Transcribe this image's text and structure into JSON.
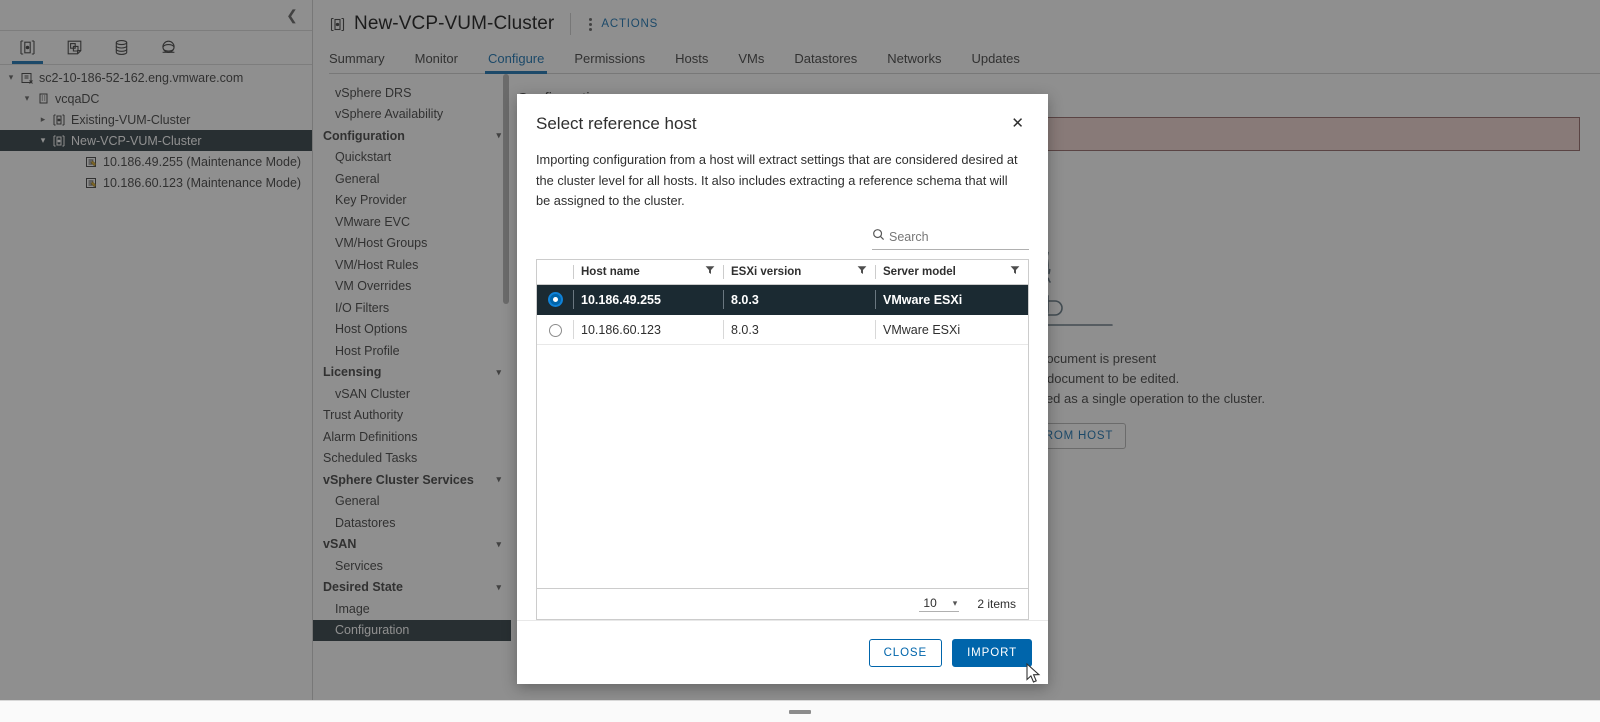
{
  "left_pane": {
    "collapse_icon": "chevron-left-icon",
    "icon_tabs": [
      {
        "name": "hosts-and-clusters-icon",
        "active": true
      },
      {
        "name": "vms-and-templates-icon",
        "active": false
      },
      {
        "name": "storage-icon",
        "active": false
      },
      {
        "name": "networking-icon",
        "active": false
      }
    ],
    "tree": [
      {
        "label": "sc2-10-186-52-162.eng.vmware.com",
        "depth": 0,
        "caret": "expanded",
        "icon": "vcenter-icon",
        "selected": false
      },
      {
        "label": "vcqaDC",
        "depth": 1,
        "caret": "expanded",
        "icon": "datacenter-icon",
        "selected": false
      },
      {
        "label": "Existing-VUM-Cluster",
        "depth": 2,
        "caret": "collapsed",
        "icon": "cluster-icon",
        "selected": false
      },
      {
        "label": "New-VCP-VUM-Cluster",
        "depth": 2,
        "caret": "expanded",
        "icon": "cluster-icon",
        "selected": true
      },
      {
        "label": "10.186.49.255 (Maintenance Mode)",
        "depth": 3,
        "caret": "none",
        "icon": "host-maintenance-icon",
        "selected": false
      },
      {
        "label": "10.186.60.123 (Maintenance Mode)",
        "depth": 3,
        "caret": "none",
        "icon": "host-maintenance-icon",
        "selected": false
      }
    ]
  },
  "header": {
    "object_icon": "cluster-icon",
    "title": "New-VCP-VUM-Cluster",
    "kebab_icon": "more-actions-icon",
    "actions_label": "ACTIONS",
    "tabs": [
      {
        "label": "Summary",
        "active": false
      },
      {
        "label": "Monitor",
        "active": false
      },
      {
        "label": "Configure",
        "active": true
      },
      {
        "label": "Permissions",
        "active": false
      },
      {
        "label": "Hosts",
        "active": false
      },
      {
        "label": "VMs",
        "active": false
      },
      {
        "label": "Datastores",
        "active": false
      },
      {
        "label": "Networks",
        "active": false
      },
      {
        "label": "Updates",
        "active": false
      }
    ]
  },
  "sub_nav": [
    {
      "label": "vSphere DRS",
      "type": "item",
      "selected": false
    },
    {
      "label": "vSphere Availability",
      "type": "item",
      "selected": false
    },
    {
      "label": "Configuration",
      "type": "group",
      "selected": false
    },
    {
      "label": "Quickstart",
      "type": "item",
      "selected": false
    },
    {
      "label": "General",
      "type": "item",
      "selected": false
    },
    {
      "label": "Key Provider",
      "type": "item",
      "selected": false
    },
    {
      "label": "VMware EVC",
      "type": "item",
      "selected": false
    },
    {
      "label": "VM/Host Groups",
      "type": "item",
      "selected": false
    },
    {
      "label": "VM/Host Rules",
      "type": "item",
      "selected": false
    },
    {
      "label": "VM Overrides",
      "type": "item",
      "selected": false
    },
    {
      "label": "I/O Filters",
      "type": "item",
      "selected": false
    },
    {
      "label": "Host Options",
      "type": "item",
      "selected": false
    },
    {
      "label": "Host Profile",
      "type": "item",
      "selected": false
    },
    {
      "label": "Licensing",
      "type": "group",
      "selected": false
    },
    {
      "label": "vSAN Cluster",
      "type": "item",
      "selected": false
    },
    {
      "label": "Trust Authority",
      "type": "item-flush",
      "selected": false
    },
    {
      "label": "Alarm Definitions",
      "type": "item-flush",
      "selected": false
    },
    {
      "label": "Scheduled Tasks",
      "type": "item-flush",
      "selected": false
    },
    {
      "label": "vSphere Cluster Services",
      "type": "group",
      "selected": false
    },
    {
      "label": "General",
      "type": "item",
      "selected": false
    },
    {
      "label": "Datastores",
      "type": "item",
      "selected": false
    },
    {
      "label": "vSAN",
      "type": "group",
      "selected": false
    },
    {
      "label": "Services",
      "type": "item",
      "selected": false
    },
    {
      "label": "Desired State",
      "type": "group",
      "selected": false
    },
    {
      "label": "Image",
      "type": "item",
      "selected": false
    },
    {
      "label": "Configuration",
      "type": "item",
      "selected": true
    }
  ],
  "panel": {
    "title": "Configuration",
    "alert_icon": "error-icon",
    "alert_text": "",
    "empty_illustration": "coffee-cup-icon",
    "empty_lines": [
      "No configuration document is present",
      "Import a configuration document to be edited.",
      "Settings in the document will be applied as a single operation to the cluster."
    ],
    "empty_button_label": "IMPORT FROM HOST"
  },
  "modal": {
    "title": "Select reference host",
    "close_icon": "close-icon",
    "description": "Importing configuration from a host will extract settings that are considered desired at the cluster level for all hosts. It also includes extracting a reference schema that will be assigned to the cluster.",
    "search": {
      "icon": "search-icon",
      "placeholder": "Search",
      "value": ""
    },
    "table": {
      "columns": [
        {
          "label": "Host name",
          "filter_icon": "filter-icon"
        },
        {
          "label": "ESXi version",
          "filter_icon": "filter-icon"
        },
        {
          "label": "Server model",
          "filter_icon": "filter-icon"
        }
      ],
      "rows": [
        {
          "selected": true,
          "host_name": "10.186.49.255",
          "esxi_version": "8.0.3",
          "server_model": "VMware ESXi"
        },
        {
          "selected": false,
          "host_name": "10.186.60.123",
          "esxi_version": "8.0.3",
          "server_model": "VMware ESXi"
        }
      ]
    },
    "footer": {
      "page_size": "10",
      "page_size_chevron": "chevron-down-icon",
      "items_count": "2 items"
    },
    "buttons": {
      "close_label": "CLOSE",
      "import_label": "IMPORT"
    }
  },
  "colors": {
    "accent_blue": "#0065ab",
    "selected_row_bg": "#1b2a32",
    "alert_bg": "#f0d0cd",
    "alert_border": "#8a5a5a"
  }
}
